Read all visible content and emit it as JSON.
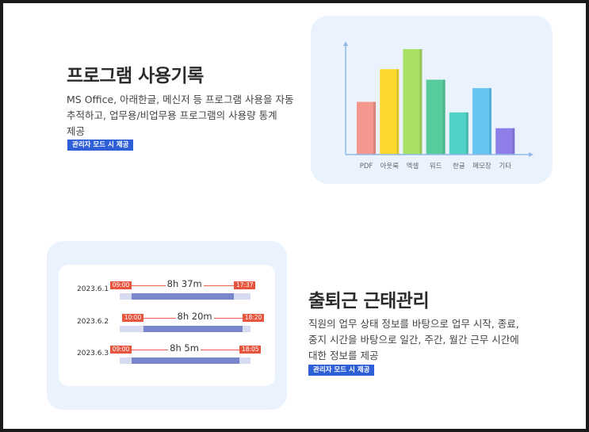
{
  "section1": {
    "title": "프로그램 사용기록",
    "desc_lines": [
      "MS Office, 아래한글, 메신저 등 프로그램 사용을 자동",
      "추적하고, 업무용/비업무용 프로그램의 사용량 통계",
      "제공"
    ],
    "badge": "관리자 모드 시 제공"
  },
  "chart_data": {
    "type": "bar",
    "categories": [
      "PDF",
      "아웃룩",
      "엑셀",
      "워드",
      "한글",
      "메모장",
      "기타"
    ],
    "values": [
      50,
      81,
      100,
      71,
      40,
      63,
      25
    ],
    "colors": [
      "#f4978e",
      "#fbd92e",
      "#a8e063",
      "#56cc9d",
      "#4fd1c5",
      "#63c5f0",
      "#8e7fe8"
    ],
    "ylim": [
      0,
      100
    ],
    "axis_color": "#8fb8e6"
  },
  "section2": {
    "title": "출퇴근 근태관리",
    "desc_lines": [
      "직원의 업무 상태 정보를 바탕으로 업무 시작, 종료,",
      "중지 시간을 바탕으로 일간, 주간, 월간 근무 시간에",
      "대한 정보를 제공"
    ],
    "badge": "관리자 모드 시 제공"
  },
  "timeline": [
    {
      "date": "2023.6.1",
      "start": "09:00",
      "end": "17:37",
      "duration": "8h 37m"
    },
    {
      "date": "2023.6.2",
      "start": "10:00",
      "end": "18:20",
      "duration": "8h 20m"
    },
    {
      "date": "2023.6.3",
      "start": "09:00",
      "end": "18:05",
      "duration": "8h 5m"
    }
  ]
}
